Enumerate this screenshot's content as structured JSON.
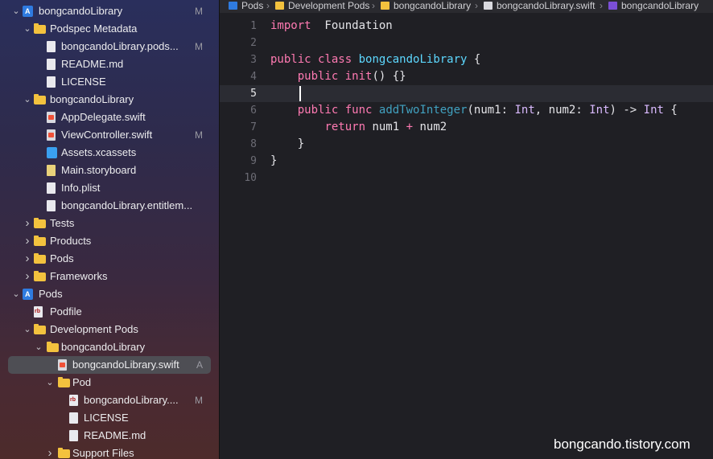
{
  "navigator": {
    "items": [
      {
        "label": "bongcandoLibrary",
        "badge": "M",
        "indent": 0,
        "chev": "v",
        "icon": "project"
      },
      {
        "label": "Podspec Metadata",
        "badge": "",
        "indent": 1,
        "chev": "v",
        "icon": "folder"
      },
      {
        "label": "bongcandoLibrary.pods...",
        "badge": "M",
        "indent": 2,
        "chev": "",
        "icon": "file"
      },
      {
        "label": "README.md",
        "badge": "",
        "indent": 2,
        "chev": "",
        "icon": "file"
      },
      {
        "label": "LICENSE",
        "badge": "",
        "indent": 2,
        "chev": "",
        "icon": "file"
      },
      {
        "label": "bongcandoLibrary",
        "badge": "",
        "indent": 1,
        "chev": "v",
        "icon": "folder"
      },
      {
        "label": "AppDelegate.swift",
        "badge": "",
        "indent": 2,
        "chev": "",
        "icon": "swift"
      },
      {
        "label": "ViewController.swift",
        "badge": "M",
        "indent": 2,
        "chev": "",
        "icon": "swift"
      },
      {
        "label": "Assets.xcassets",
        "badge": "",
        "indent": 2,
        "chev": "",
        "icon": "assets"
      },
      {
        "label": "Main.storyboard",
        "badge": "",
        "indent": 2,
        "chev": "",
        "icon": "storyboard"
      },
      {
        "label": "Info.plist",
        "badge": "",
        "indent": 2,
        "chev": "",
        "icon": "file"
      },
      {
        "label": "bongcandoLibrary.entitlem...",
        "badge": "",
        "indent": 2,
        "chev": "",
        "icon": "entitle"
      },
      {
        "label": "Tests",
        "badge": "",
        "indent": 1,
        "chev": ">",
        "icon": "folder"
      },
      {
        "label": "Products",
        "badge": "",
        "indent": 1,
        "chev": ">",
        "icon": "folder"
      },
      {
        "label": "Pods",
        "badge": "",
        "indent": 1,
        "chev": ">",
        "icon": "folder"
      },
      {
        "label": "Frameworks",
        "badge": "",
        "indent": 1,
        "chev": ">",
        "icon": "folder"
      },
      {
        "label": "Pods",
        "badge": "",
        "indent": 0,
        "chev": "v",
        "icon": "project"
      },
      {
        "label": "Podfile",
        "badge": "",
        "indent": 1,
        "chev": "",
        "icon": "rb"
      },
      {
        "label": "Development Pods",
        "badge": "",
        "indent": 1,
        "chev": "v",
        "icon": "folder"
      },
      {
        "label": "bongcandoLibrary",
        "badge": "",
        "indent": 2,
        "chev": "v",
        "icon": "folder"
      },
      {
        "label": "bongcandoLibrary.swift",
        "badge": "A",
        "indent": 3,
        "chev": "",
        "icon": "swift",
        "selected": true
      },
      {
        "label": "Pod",
        "badge": "",
        "indent": 3,
        "chev": "v",
        "icon": "folder"
      },
      {
        "label": "bongcandoLibrary....",
        "badge": "M",
        "indent": 4,
        "chev": "",
        "icon": "rb"
      },
      {
        "label": "LICENSE",
        "badge": "",
        "indent": 4,
        "chev": "",
        "icon": "file"
      },
      {
        "label": "README.md",
        "badge": "",
        "indent": 4,
        "chev": "",
        "icon": "file"
      },
      {
        "label": "Support Files",
        "badge": "",
        "indent": 3,
        "chev": ">",
        "icon": "folder"
      }
    ]
  },
  "breadcrumb": {
    "items": [
      "Pods",
      "Development Pods",
      "bongcandoLibrary",
      "bongcandoLibrary.swift",
      "bongcandoLibrary"
    ]
  },
  "editor": {
    "current_line": 5,
    "lines": [
      [
        [
          "kw",
          "import"
        ],
        [
          "",
          "  Foundation"
        ]
      ],
      [],
      [
        [
          "kw",
          "public"
        ],
        [
          "",
          " "
        ],
        [
          "kw",
          "class"
        ],
        [
          "",
          " "
        ],
        [
          "ty",
          "bongcandoLibrary"
        ],
        [
          "",
          " {"
        ]
      ],
      [
        [
          "",
          "    "
        ],
        [
          "kw",
          "public"
        ],
        [
          "",
          " "
        ],
        [
          "kw",
          "init"
        ],
        [
          "",
          "() {}"
        ]
      ],
      [],
      [
        [
          "",
          "    "
        ],
        [
          "kw",
          "public"
        ],
        [
          "",
          " "
        ],
        [
          "kw",
          "func"
        ],
        [
          "",
          " "
        ],
        [
          "fnc",
          "addTwoInteger"
        ],
        [
          "",
          "(num1: "
        ],
        [
          "typ",
          "Int"
        ],
        [
          "",
          ", num2: "
        ],
        [
          "typ",
          "Int"
        ],
        [
          "",
          ") -> "
        ],
        [
          "typ",
          "Int"
        ],
        [
          "",
          " {"
        ]
      ],
      [
        [
          "",
          "        "
        ],
        [
          "kw",
          "return"
        ],
        [
          "",
          " num1 "
        ],
        [
          "op",
          "+"
        ],
        [
          "",
          " num2"
        ]
      ],
      [
        [
          "",
          "    }"
        ]
      ],
      [
        [
          "",
          "}"
        ]
      ],
      []
    ],
    "line_numbers": [
      "1",
      "2",
      "3",
      "4",
      "5",
      "6",
      "7",
      "8",
      "9",
      "10"
    ]
  },
  "watermark": "bongcando.tistory.com"
}
